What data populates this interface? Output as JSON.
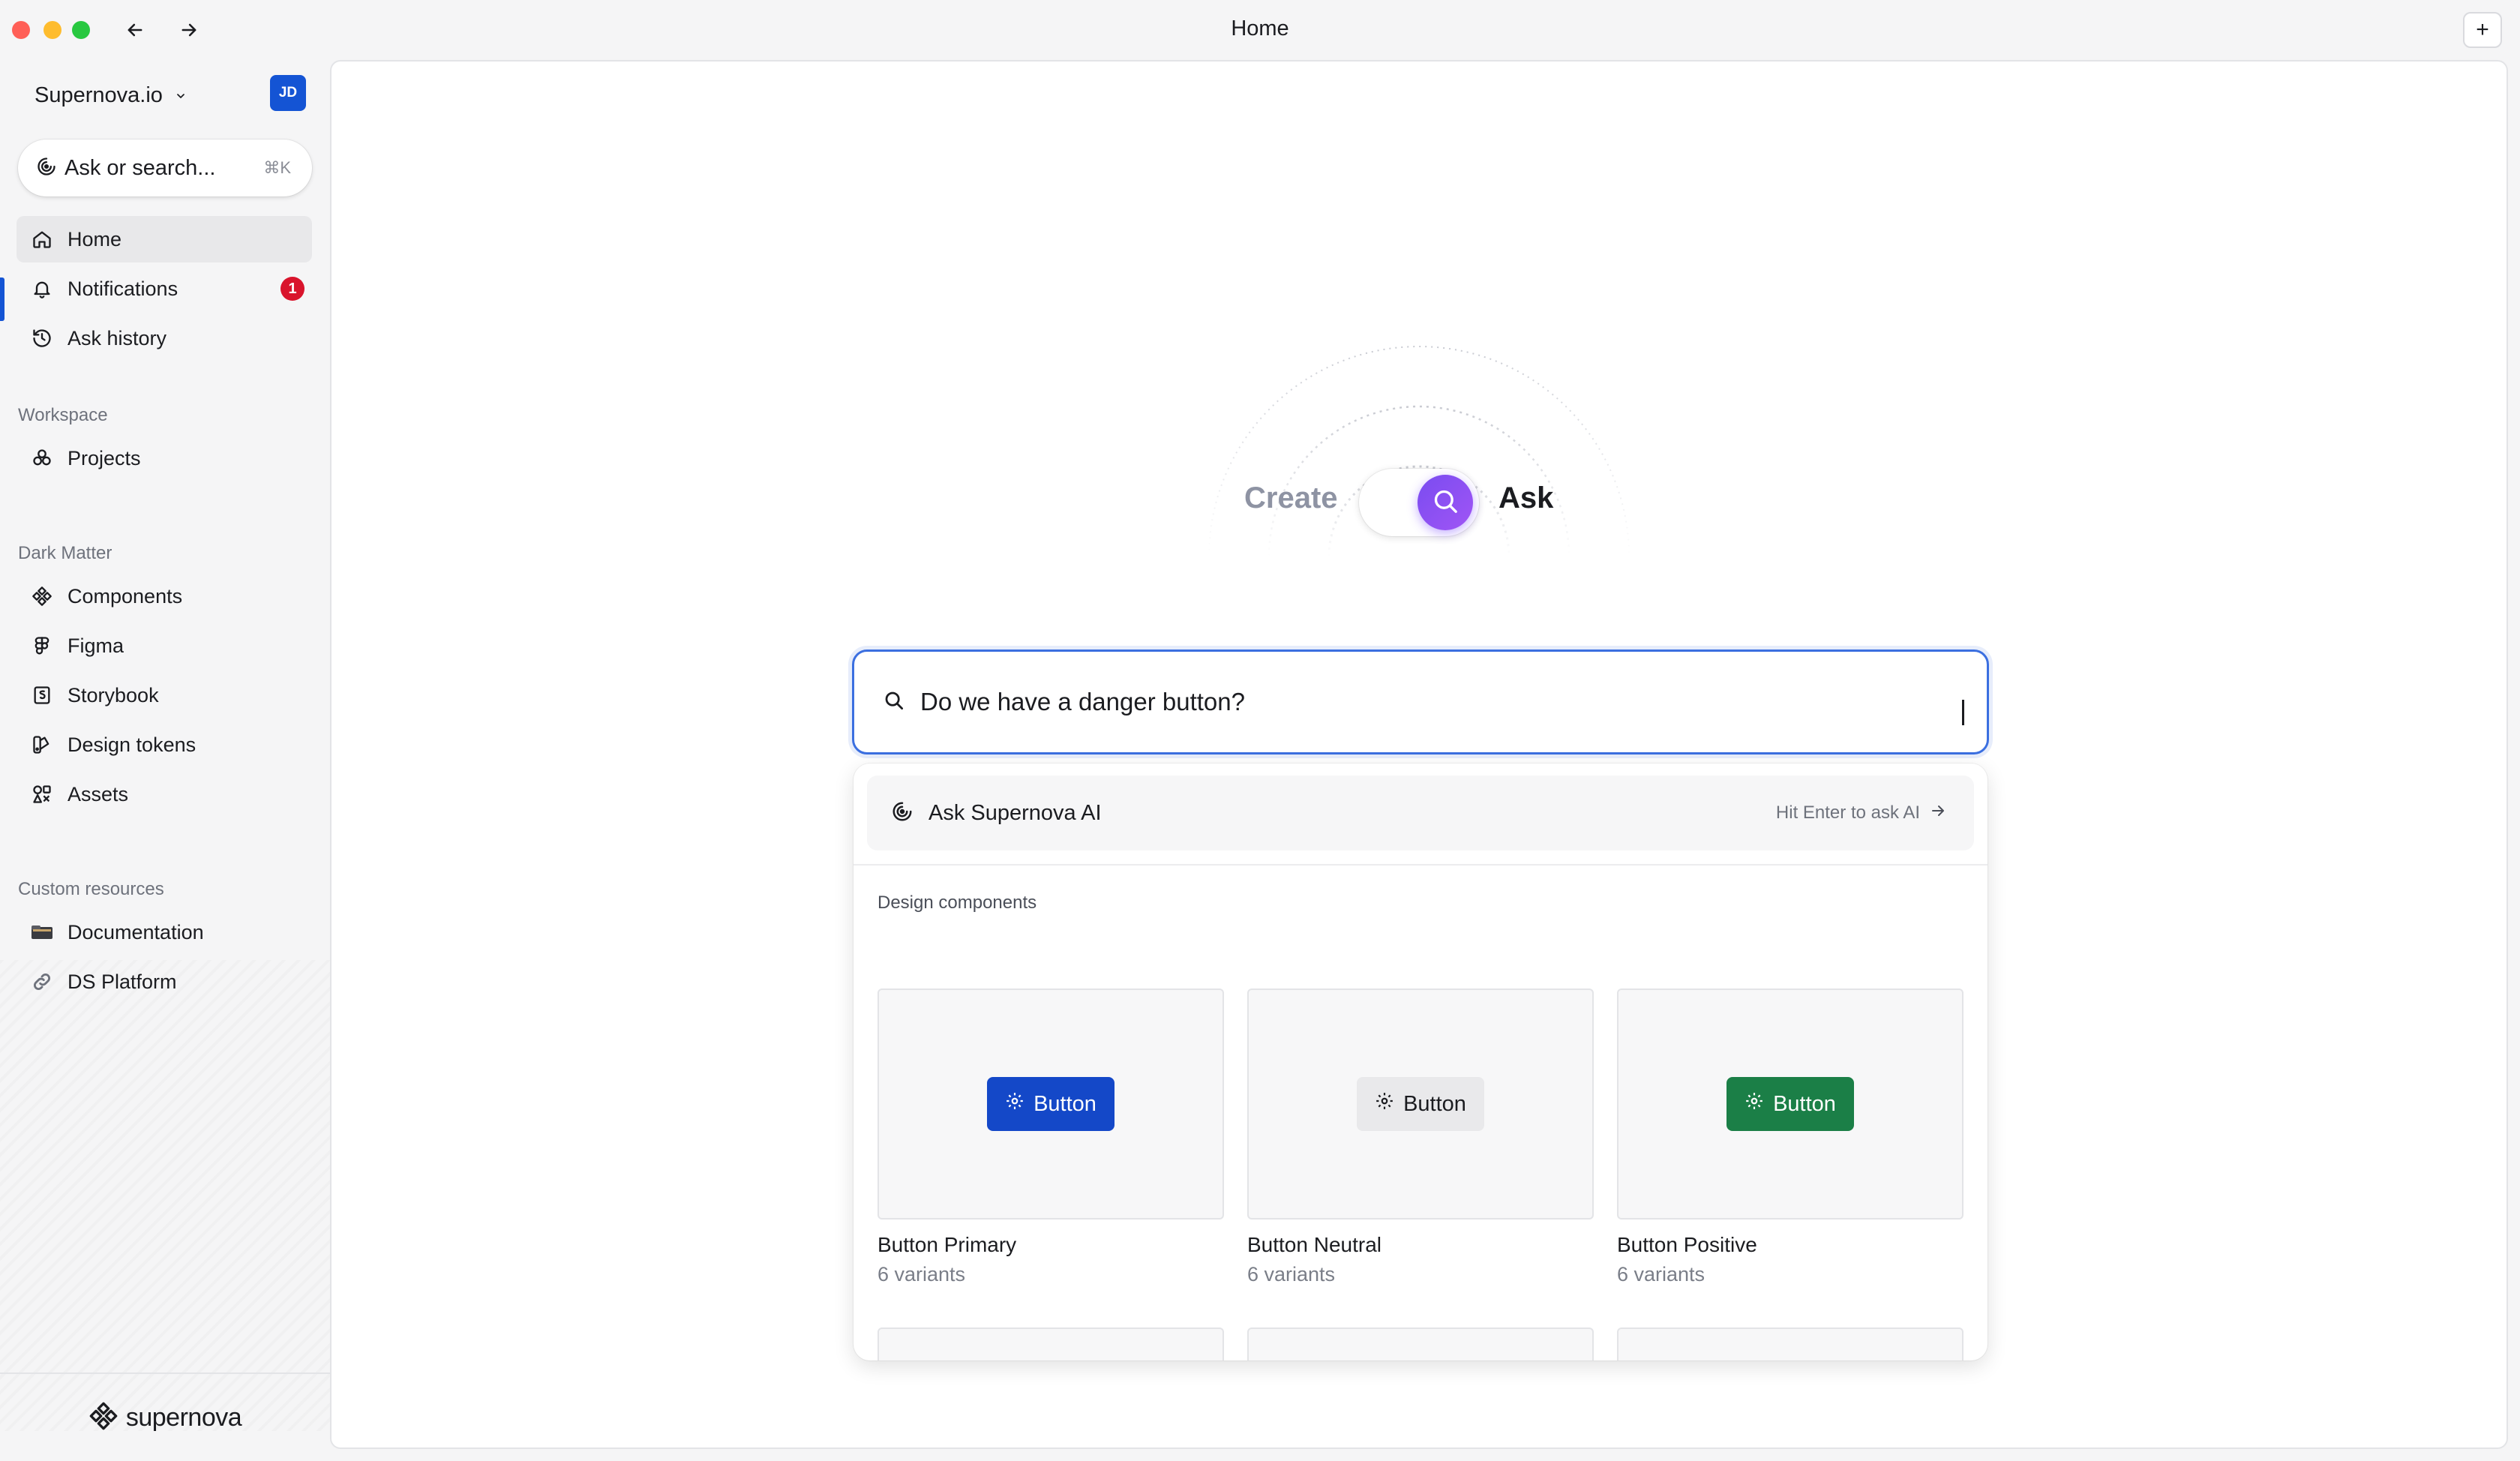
{
  "window": {
    "title": "Home",
    "new_tab_label": "+"
  },
  "sidebar": {
    "workspace_name": "Supernova.io",
    "avatar_initials": "JD",
    "search": {
      "placeholder": "Ask or search...",
      "shortcut": "⌘K"
    },
    "primary_items": [
      {
        "label": "Home",
        "icon": "home-icon",
        "active": true
      },
      {
        "label": "Notifications",
        "icon": "bell-icon",
        "badge": "1"
      },
      {
        "label": "Ask history",
        "icon": "history-icon"
      }
    ],
    "sections": [
      {
        "title": "Workspace",
        "items": [
          {
            "label": "Projects",
            "icon": "projects-icon"
          }
        ]
      },
      {
        "title": "Dark Matter",
        "items": [
          {
            "label": "Components",
            "icon": "components-icon"
          },
          {
            "label": "Figma",
            "icon": "figma-icon"
          },
          {
            "label": "Storybook",
            "icon": "storybook-icon"
          },
          {
            "label": "Design tokens",
            "icon": "design-tokens-icon"
          },
          {
            "label": "Assets",
            "icon": "assets-icon"
          }
        ]
      },
      {
        "title": "Custom resources",
        "items": [
          {
            "label": "Documentation",
            "icon": "documentation-icon"
          },
          {
            "label": "DS Platform",
            "icon": "link-icon"
          }
        ]
      }
    ],
    "footer_brand": "supernova"
  },
  "main": {
    "mode_toggle": {
      "left_label": "Create",
      "right_label": "Ask",
      "selected": "Ask"
    },
    "ask_input": {
      "value": "Do we have a danger button?"
    },
    "dropdown": {
      "ai_row": {
        "label": "Ask Supernova AI",
        "hint": "Hit Enter to ask AI"
      },
      "section_title": "Design components",
      "components": [
        {
          "title": "Button Primary",
          "subtitle": "6 variants",
          "preview_label": "Button",
          "preview_color": "#1448c8"
        },
        {
          "title": "Button Neutral",
          "subtitle": "6 variants",
          "preview_label": "Button",
          "preview_color": "#e9e9eb"
        },
        {
          "title": "Button Positive",
          "subtitle": "6 variants",
          "preview_label": "Button",
          "preview_color": "#1b7f47"
        }
      ]
    }
  },
  "colors": {
    "accent": "#1454d4",
    "ask_gradient_start": "#7a4cf0",
    "badge_red": "#d9142c"
  }
}
